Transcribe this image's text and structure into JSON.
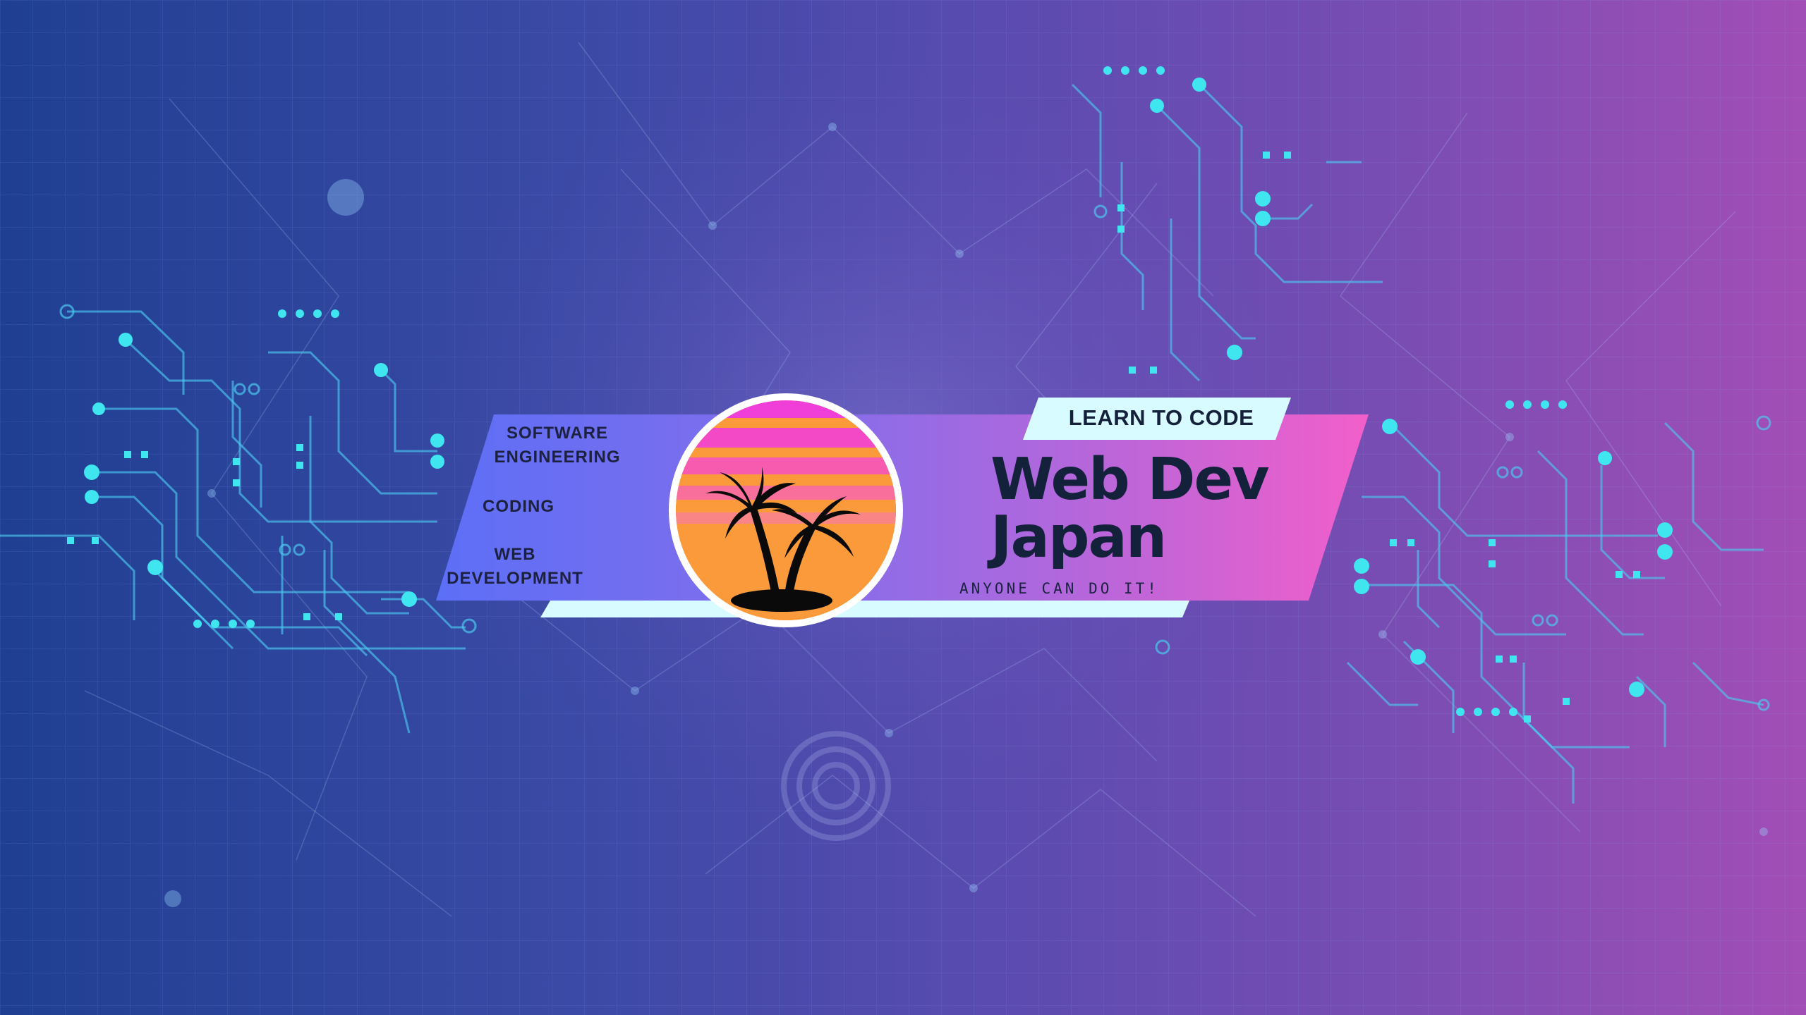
{
  "banner": {
    "tags": {
      "software": "SOFTWARE",
      "engineering": "ENGINEERING",
      "coding": "CODING",
      "web": "WEB",
      "development": "DEVELOPMENT"
    },
    "learn_label": "LEARN TO CODE",
    "title_line1": "Web Dev",
    "title_line2": "Japan",
    "tagline": "ANYONE CAN DO IT!",
    "logo_icon": "palm-tree-sunset-icon"
  },
  "colors": {
    "bg_left": "#1f3f92",
    "bg_right": "#a24eb6",
    "circuit_cyan": "#3fe6f0",
    "band_left": "#5c6ff7",
    "band_right": "#f25fca",
    "label_bg": "#d8fbff",
    "title_text": "#14213a",
    "sun_pink": "#f03fd8",
    "sun_orange": "#fb9a3a"
  }
}
